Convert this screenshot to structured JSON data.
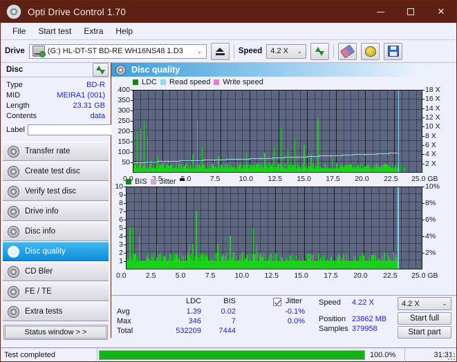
{
  "window": {
    "title": "Opti Drive Control 1.70",
    "icon": "disc-icon",
    "minimize": "–",
    "maximize": "□",
    "close": "✕"
  },
  "menu": {
    "items": [
      {
        "label": "File",
        "accel": "F"
      },
      {
        "label": "Start test",
        "accel": "S"
      },
      {
        "label": "Extra",
        "accel": "x"
      },
      {
        "label": "Help",
        "accel": "H"
      }
    ]
  },
  "toolbar": {
    "drive_label": "Drive",
    "drive_value": "(G:)   HL-DT-ST BD-RE  WH16NS48 1.D3",
    "eject_title": "Eject",
    "speed_label": "Speed",
    "speed_value": "4.2 X",
    "refresh_title": "Refresh",
    "erase_title": "Erase",
    "bulb_title": "Extra",
    "save_title": "Save",
    "chevron": "⌄"
  },
  "disc_panel": {
    "header": "Disc",
    "refresh_title": "Rescan disc",
    "rows": [
      {
        "key": "Type",
        "value": "BD-R"
      },
      {
        "key": "MID",
        "value": "MEIRA1 (001)"
      },
      {
        "key": "Length",
        "value": "23.31 GB"
      },
      {
        "key": "Contents",
        "value": "data"
      }
    ],
    "label_key": "Label",
    "label_value": "",
    "label_placeholder": ""
  },
  "sidebar": {
    "items": [
      {
        "label": "Transfer rate",
        "active": false
      },
      {
        "label": "Create test disc",
        "active": false
      },
      {
        "label": "Verify test disc",
        "active": false
      },
      {
        "label": "Drive info",
        "active": false
      },
      {
        "label": "Disc info",
        "active": false
      },
      {
        "label": "Disc quality",
        "active": true
      },
      {
        "label": "CD Bler",
        "active": false
      },
      {
        "label": "FE / TE",
        "active": false
      },
      {
        "label": "Extra tests",
        "active": false
      }
    ],
    "status_window_button": "Status window > >"
  },
  "panel": {
    "title": "Disc quality"
  },
  "stats": {
    "col_ldc": "LDC",
    "col_bis": "BIS",
    "jitter_label": "Jitter",
    "jitter_checked": true,
    "rows": [
      {
        "name": "Avg",
        "ldc": "1.39",
        "bis": "0.02",
        "jitter": "-0.1%"
      },
      {
        "name": "Max",
        "ldc": "346",
        "bis": "7",
        "jitter": "0.0%"
      },
      {
        "name": "Total",
        "ldc": "532209",
        "bis": "7444",
        "jitter": ""
      }
    ],
    "speed_label": "Speed",
    "speed_value": "4.22 X",
    "position_label": "Position",
    "position_value": "23862 MB",
    "samples_label": "Samples",
    "samples_value": "379958",
    "speed_select": "4.2 X",
    "start_full": "Start full",
    "start_part": "Start part"
  },
  "statusbar": {
    "message": "Test completed",
    "percent_text": "100.0%",
    "percent_value": 100,
    "elapsed": "31:31"
  },
  "colors": {
    "titlebar": "#5c2113",
    "accent": "#0c8ddd",
    "plot_bg": "#5d6782",
    "ldc_green": "#19d219",
    "read_speed": "#8ed8f8",
    "write_speed": "#f07ad0",
    "jitter": "#c9a8d8",
    "value_blue": "#2020c8",
    "progress": "#12b312"
  },
  "chart_data": [
    {
      "type": "bar",
      "id": "ldc-chart",
      "title": "",
      "legend": [
        {
          "label": "LDC",
          "color": "#0f8a0f"
        },
        {
          "label": "Read speed",
          "color": "#8ed8f8"
        },
        {
          "label": "Write speed",
          "color": "#f07ad0"
        }
      ],
      "legend_position": "top-left",
      "xlabel": "GB",
      "ylabel": "",
      "xlim": [
        0,
        25.0
      ],
      "ylim": [
        0,
        400
      ],
      "y2lim": [
        0,
        18
      ],
      "y2label": "X",
      "xticks": [
        0.0,
        2.5,
        5.0,
        7.5,
        10.0,
        12.5,
        15.0,
        17.5,
        20.0,
        22.5,
        25.0
      ],
      "xticklabels": [
        "0.0",
        "2.5",
        "5.0",
        "7.5",
        "10.0",
        "12.5",
        "15.0",
        "17.5",
        "20.0",
        "22.5",
        "25.0 GB"
      ],
      "yticks": [
        50,
        100,
        150,
        200,
        250,
        300,
        350,
        400
      ],
      "yticklabels": [
        "50",
        "100",
        "150",
        "200",
        "250",
        "300",
        "350",
        "400"
      ],
      "y2ticks": [
        2,
        4,
        6,
        8,
        10,
        12,
        14,
        16,
        18
      ],
      "y2ticklabels": [
        "2 X",
        "4 X",
        "6 X",
        "8 X",
        "10 X",
        "12 X",
        "14 X",
        "16 X",
        "18 X"
      ],
      "grid": true,
      "series": [
        {
          "name": "LDC",
          "color": "#19d219",
          "x": [
            0.15,
            0.3,
            0.45,
            0.6,
            0.75,
            0.9,
            1.05,
            1.2,
            1.35,
            1.5,
            1.7,
            1.9,
            2.1,
            2.3,
            2.5,
            2.7,
            2.9,
            3.1,
            3.3,
            3.5,
            3.7,
            3.9,
            4.1,
            4.3,
            4.5,
            4.7,
            4.9,
            5.1,
            5.3,
            5.5,
            5.7,
            5.9,
            6.1,
            6.3,
            6.5,
            6.7,
            6.9,
            7.1,
            7.3,
            7.5,
            7.7,
            7.9,
            8.1,
            8.3,
            8.5,
            8.7,
            8.9,
            9.1,
            9.3,
            9.5,
            9.7,
            9.9,
            10.1,
            10.3,
            10.5,
            10.7,
            10.9,
            11.1,
            11.3,
            11.5,
            11.7,
            11.9,
            12.1,
            12.3,
            12.5,
            12.7,
            12.9,
            13.1,
            13.3,
            13.5,
            13.7,
            13.9,
            14.1,
            14.3,
            14.5,
            14.7,
            14.9,
            15.1,
            15.3,
            15.5,
            15.7,
            15.9,
            16.1,
            16.3,
            16.5,
            16.7,
            16.9,
            17.1,
            17.3,
            17.5,
            17.7,
            17.9,
            18.1,
            18.3,
            18.5,
            18.7,
            18.9,
            19.1,
            19.3,
            19.5,
            19.7,
            19.9,
            20.1,
            20.3,
            20.5,
            20.7,
            20.9,
            21.1,
            21.3,
            21.5,
            21.7,
            21.9,
            22.1,
            22.3,
            22.5,
            22.7,
            22.9,
            23.1,
            23.3
          ],
          "values": [
            40,
            196,
            32,
            210,
            30,
            245,
            28,
            166,
            26,
            60,
            24,
            22,
            72,
            20,
            48,
            18,
            20,
            16,
            30,
            18,
            55,
            20,
            18,
            16,
            40,
            24,
            20,
            88,
            18,
            256,
            20,
            120,
            18,
            40,
            20,
            26,
            18,
            20,
            76,
            20,
            18,
            22,
            18,
            16,
            18,
            20,
            18,
            26,
            18,
            20,
            90,
            18,
            16,
            18,
            20,
            44,
            18,
            20,
            92,
            18,
            16,
            20,
            118,
            18,
            20,
            212,
            22,
            18,
            106,
            16,
            18,
            156,
            20,
            16,
            18,
            130,
            18,
            20,
            84,
            18,
            22,
            258,
            20,
            18,
            40,
            18,
            20,
            70,
            18,
            44,
            20,
            18,
            24,
            20,
            18,
            22,
            20,
            18,
            26,
            18,
            20,
            30,
            18,
            22,
            20,
            18,
            26,
            18,
            22,
            20,
            18,
            24,
            20,
            18,
            22,
            20,
            18,
            40,
            24
          ]
        },
        {
          "name": "Read speed",
          "color": "#8ed8f8",
          "x": [
            0.0,
            1.0,
            2.0,
            3.0,
            4.0,
            5.0,
            6.0,
            7.0,
            8.0,
            9.0,
            10.0,
            11.0,
            12.0,
            13.0,
            14.0,
            15.0,
            16.0,
            17.0,
            18.0,
            19.0,
            20.0,
            21.0,
            22.0,
            22.8
          ],
          "values": [
            2.0,
            2.1,
            2.2,
            2.3,
            2.4,
            2.45,
            2.5,
            2.6,
            2.7,
            2.75,
            2.8,
            2.9,
            3.0,
            3.1,
            3.2,
            3.3,
            3.45,
            3.5,
            3.6,
            3.7,
            3.8,
            3.9,
            4.0,
            4.1
          ]
        }
      ],
      "markers": [
        {
          "type": "vline",
          "x": 22.85,
          "color": "#79d4f2"
        }
      ]
    },
    {
      "type": "bar",
      "id": "bis-chart",
      "title": "",
      "legend": [
        {
          "label": "BIS",
          "color": "#0f8a0f"
        },
        {
          "label": "Jitter",
          "color": "#c9a8d8"
        }
      ],
      "legend_position": "top-left",
      "xlabel": "GB",
      "ylabel": "",
      "xlim": [
        0,
        25.0
      ],
      "ylim": [
        0,
        10
      ],
      "y2lim": [
        0,
        10
      ],
      "y2label": "%",
      "xticks": [
        0.0,
        2.5,
        5.0,
        7.5,
        10.0,
        12.5,
        15.0,
        17.5,
        20.0,
        22.5,
        25.0
      ],
      "xticklabels": [
        "0.0",
        "2.5",
        "5.0",
        "7.5",
        "10.0",
        "12.5",
        "15.0",
        "17.5",
        "20.0",
        "22.5",
        "25.0 GB"
      ],
      "yticks": [
        1,
        2,
        3,
        4,
        5,
        6,
        7,
        8,
        9,
        10
      ],
      "yticklabels": [
        "1",
        "2",
        "3",
        "4",
        "5",
        "6",
        "7",
        "8",
        "9",
        "10"
      ],
      "y2ticks": [
        2,
        4,
        6,
        8,
        10
      ],
      "y2ticklabels": [
        "2%",
        "4%",
        "6%",
        "8%",
        "10%"
      ],
      "grid": true,
      "series": [
        {
          "name": "BIS",
          "color": "#19d219",
          "x": [
            0.1,
            0.25,
            0.4,
            0.5,
            0.6,
            0.75,
            0.9,
            1.05,
            1.2,
            1.35,
            1.5,
            1.65,
            1.8,
            1.95,
            2.1,
            2.25,
            2.4,
            2.55,
            2.7,
            2.85,
            3.0,
            3.15,
            3.3,
            3.45,
            3.6,
            3.75,
            3.9,
            4.05,
            4.2,
            4.35,
            4.5,
            4.65,
            4.8,
            4.95,
            5.1,
            5.25,
            5.4,
            5.55,
            5.7,
            5.85,
            6.0,
            6.15,
            6.3,
            6.45,
            6.6,
            6.75,
            6.9,
            7.05,
            7.2,
            7.35,
            7.5,
            7.65,
            7.8,
            7.95,
            8.1,
            8.25,
            8.4,
            8.55,
            8.7,
            8.85,
            9.0,
            9.15,
            9.3,
            9.45,
            9.6,
            9.75,
            9.9,
            10.05,
            10.2,
            10.35,
            10.5,
            10.65,
            10.8,
            10.95,
            11.1,
            11.25,
            11.4,
            11.55,
            11.7,
            11.85,
            12.0,
            12.3,
            12.6,
            12.9,
            13.2,
            13.5,
            13.8,
            14.1,
            14.4,
            14.7,
            15.0,
            15.3,
            15.6,
            15.9,
            16.2,
            16.5,
            16.8,
            17.1,
            17.4,
            17.7,
            18.0,
            18.3,
            18.6,
            18.9,
            19.2,
            19.5,
            19.8,
            20.1,
            20.4,
            20.7,
            21.0,
            21.3,
            21.6,
            21.9,
            22.2,
            22.5,
            22.8
          ],
          "values": [
            1,
            5,
            1,
            5,
            1,
            2,
            1,
            4,
            1,
            1,
            1,
            1,
            2,
            1,
            1,
            2,
            1,
            3,
            1,
            2,
            1,
            1,
            1,
            1,
            1,
            1,
            1,
            1,
            1,
            1,
            1,
            1,
            1,
            1,
            2,
            3,
            1,
            3,
            1,
            7,
            1,
            1,
            2,
            1,
            1,
            1,
            1,
            1,
            1,
            1,
            1,
            3,
            1,
            1,
            1,
            1,
            2,
            1,
            4,
            1,
            2,
            1,
            1,
            1,
            1,
            2,
            1,
            1,
            1,
            1,
            1,
            5,
            1,
            3,
            1,
            2,
            1,
            2,
            1,
            1,
            1,
            1,
            1,
            1,
            1,
            1,
            1,
            1,
            1,
            1,
            1,
            1,
            1,
            1,
            1,
            1,
            1,
            1,
            1,
            1,
            1,
            1,
            1,
            1,
            1,
            1,
            1,
            1,
            1,
            1,
            1,
            1,
            1,
            2,
            1,
            2,
            1
          ]
        }
      ],
      "markers": [
        {
          "type": "vline",
          "x": 22.85,
          "color": "#79d4f2"
        }
      ]
    }
  ]
}
